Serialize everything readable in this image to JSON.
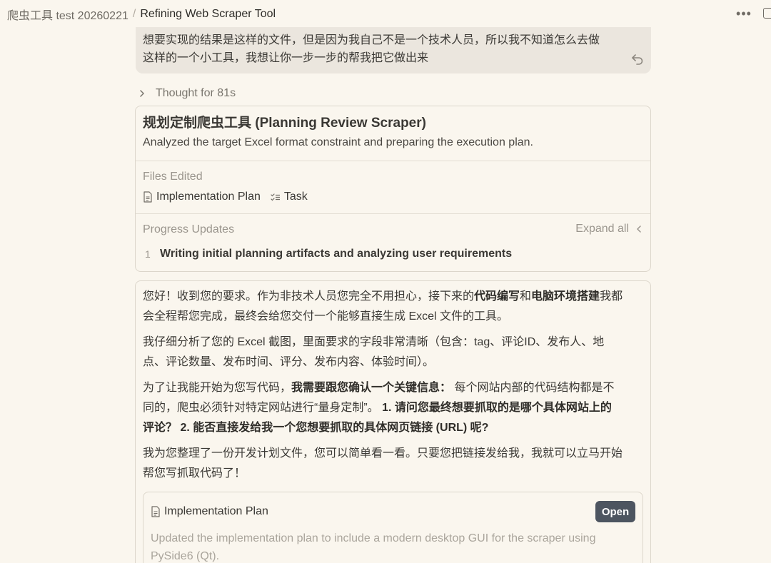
{
  "header": {
    "root": "爬虫工具 test 20260221",
    "separator": "/",
    "title": "Refining Web Scraper Tool",
    "more": "•••"
  },
  "user_message": {
    "line1": "想要实现的结果是这样的文件，但是因为我自己不是一个技术人员，所以我不知道怎么去做",
    "line2": "这样的一个小工具，我想让你一步一步的帮我把它做出来"
  },
  "thought": {
    "label": "Thought for 81s"
  },
  "task": {
    "title": "规划定制爬虫工具 (Planning Review Scraper)",
    "subtitle": "Analyzed the target Excel format constraint and preparing the execution plan.",
    "files_label": "Files Edited",
    "files": [
      {
        "icon": "document-icon",
        "label": "Implementation Plan"
      },
      {
        "icon": "checklist-icon",
        "label": "Task"
      }
    ],
    "progress_label": "Progress Updates",
    "expand_all": "Expand all",
    "progress": [
      {
        "num": "1",
        "text": "Writing initial planning artifacts and analyzing user requirements"
      }
    ]
  },
  "reply": {
    "p1_a": "您好！收到您的要求。作为非技术人员您完全不用担心，接下来的",
    "p1_b": "代码编写",
    "p1_c": "和",
    "p1_d": "电脑环境搭建",
    "p1_e": "我都",
    "p1_f": "会全程帮您完成，最终会给您交付一个能够直接生成 Excel 文件的工具。",
    "p2_a": "我仔细分析了您的 Excel 截图，里面要求的字段非常清晰（包含：tag、评论ID、发布人、地",
    "p2_b": "点、评论数量、发布时间、评分、发布内容、体验时间）。",
    "p3_a": "为了让我能开始为您写代码，",
    "p3_b": "我需要跟您确认一个关键信息：",
    "p3_c": " 每个网站内部的代码结构都是不",
    "p3_d": "同的，爬虫必须针对特定网站进行“量身定制”。",
    "p3_e": " 1. 请问您最终想要抓取的是哪个具体网站上的",
    "p3_f": "评论？ 2. 能否直接发给我一个您想要抓取的具体网页链接 (URL) 呢?",
    "p4_a": "我为您整理了一份开发计划文件，您可以简单看一看。只要您把链接发给我，我就可以立马开始",
    "p4_b": "帮您写抓取代码了！"
  },
  "artifact": {
    "title": "Implementation Plan",
    "open_label": "Open",
    "desc_line1": "Updated the implementation plan to include a modern desktop GUI for the scraper using",
    "desc_line2": "PySide6 (Qt)."
  }
}
